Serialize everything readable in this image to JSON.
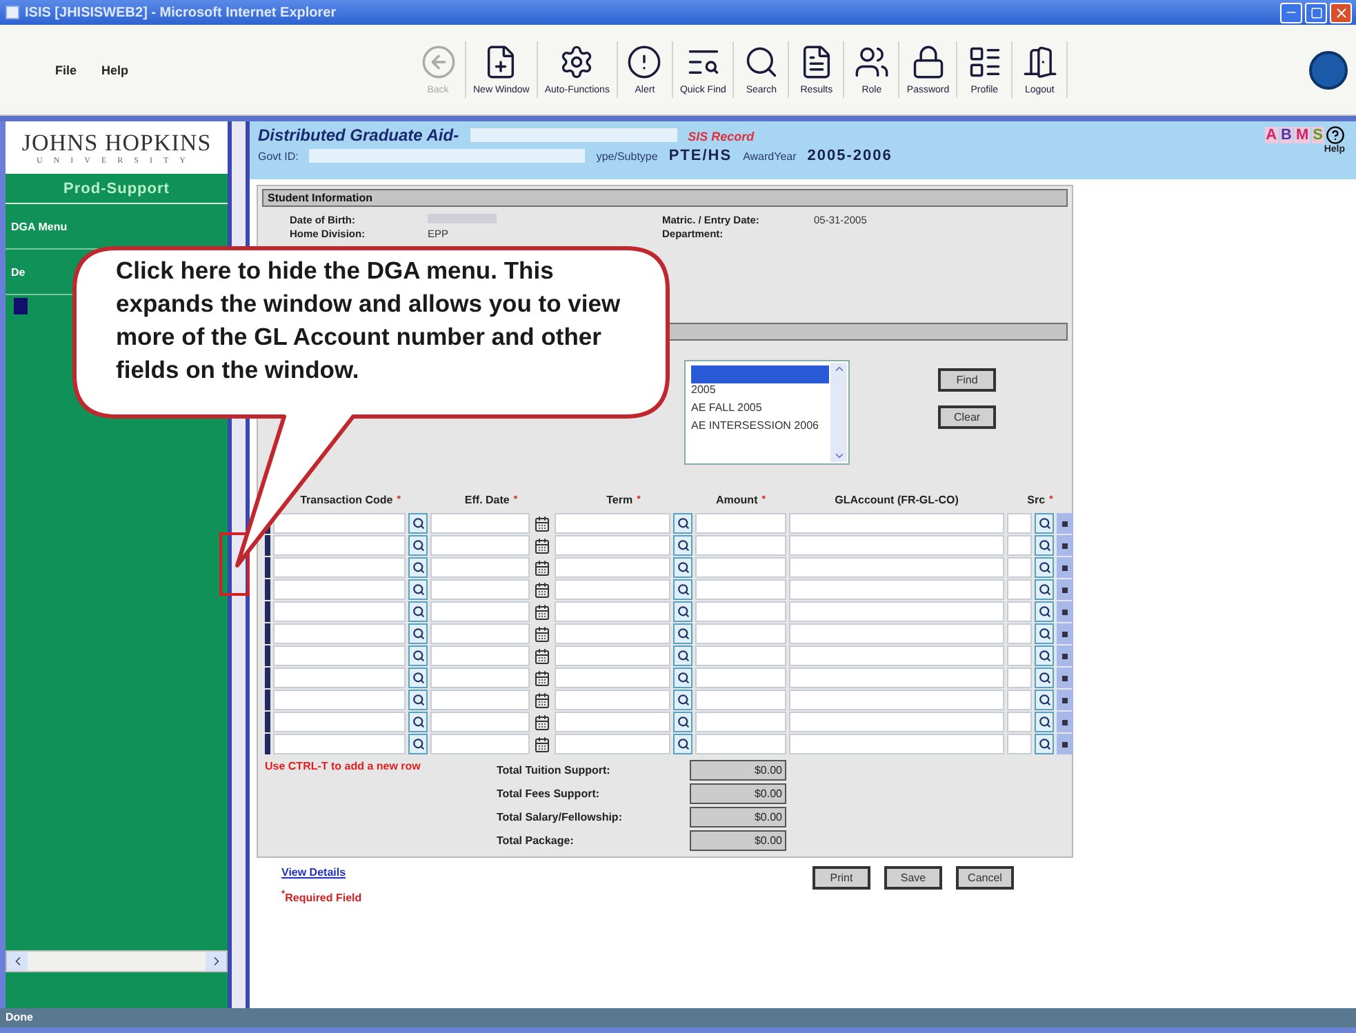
{
  "window": {
    "title": "ISIS [JHISISWEB2] - Microsoft Internet Explorer"
  },
  "menu": [
    "File",
    "Help"
  ],
  "toolbar": [
    {
      "label": "Back",
      "disabled": true
    },
    {
      "label": "New Window",
      "disabled": false
    },
    {
      "label": "Auto-Functions",
      "disabled": false
    },
    {
      "label": "Alert",
      "disabled": false
    },
    {
      "label": "Quick Find",
      "disabled": false
    },
    {
      "label": "Search",
      "disabled": false
    },
    {
      "label": "Results",
      "disabled": false
    },
    {
      "label": "Role",
      "disabled": false
    },
    {
      "label": "Password",
      "disabled": false
    },
    {
      "label": "Profile",
      "disabled": false
    },
    {
      "label": "Logout",
      "disabled": false
    }
  ],
  "sidebar": {
    "logo": "JOHNS HOPKINS",
    "logo_sub": "UNIVERSITY",
    "heading": "Prod-Support",
    "items": [
      "DGA Menu",
      "De"
    ]
  },
  "header": {
    "title": "Distributed Graduate Aid-",
    "record": "SIS Record",
    "govt_label": "Govt ID:",
    "type_label": "ype/Subtype",
    "type_value": "PTE/HS",
    "year_label": "AwardYear",
    "year_value": "2005-2006",
    "help": "Help",
    "abms": [
      {
        "letter": "A",
        "color": "#c8286a"
      },
      {
        "letter": "B",
        "color": "#4a3aa8"
      },
      {
        "letter": "M",
        "color": "#c8286a"
      },
      {
        "letter": "S",
        "color": "#5aa028"
      }
    ]
  },
  "student_info": {
    "title": "Student Information",
    "fields": [
      {
        "label": "Date of Birth:",
        "redacted": true
      },
      {
        "label": "Matric. / Entry Date:",
        "value": "05-31-2005"
      },
      {
        "label": "Home Division:",
        "value": "EPP"
      },
      {
        "label": "Department:"
      }
    ]
  },
  "term_list": {
    "items": [
      {
        "selected": true
      },
      {
        "label": "2005",
        "selected": false
      },
      {
        "label": "AE FALL 2005",
        "selected": false
      },
      {
        "label": "AE INTERSESSION 2006",
        "selected": false
      }
    ]
  },
  "term_buttons": [
    "Find",
    "Clear"
  ],
  "columns": [
    {
      "label": "Transaction Code",
      "required_mark": "*"
    },
    {
      "label": "Eff. Date",
      "required_mark": "*"
    },
    {
      "label": "Term",
      "required_mark": "*"
    },
    {
      "label": "Amount",
      "required_mark": "*"
    },
    {
      "label": "GLAccount (FR-GL-CO)"
    },
    {
      "label": "Src",
      "required_mark": "*"
    }
  ],
  "add_row_hint": "Use CTRL-T to add a new row",
  "totals": [
    {
      "label": "Total Tuition Support:",
      "value": "$0.00"
    },
    {
      "label": "Total Fees Support:",
      "value": "$0.00"
    },
    {
      "label": "Total Salary/Fellowship:",
      "value": "$0.00"
    },
    {
      "label": "Total Package:",
      "value": "$0.00"
    }
  ],
  "view_details": "View Details",
  "required_note": {
    "mark": "*",
    "text": "Required Field"
  },
  "actions": [
    "Print",
    "Save",
    "Cancel"
  ],
  "status_bar": "Done",
  "callout": {
    "lines": [
      "Click here to hide the DGA menu. This",
      "expands the window and allows you to view",
      "more of the GL Account number and other",
      "fields on the window."
    ]
  }
}
